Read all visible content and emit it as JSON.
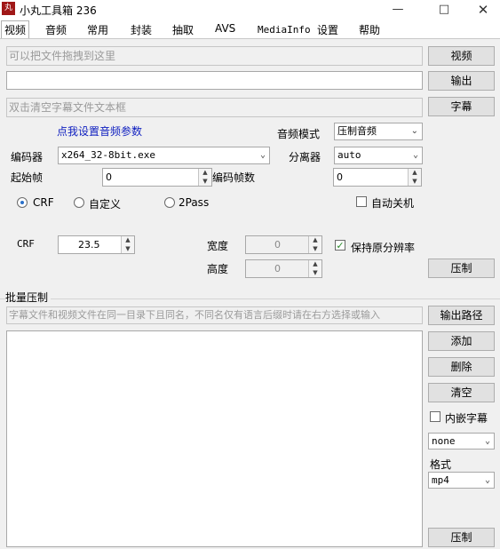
{
  "window": {
    "title": "小丸工具箱 236",
    "icon_label": "丸",
    "controls": [
      "minimize-icon",
      "maximize-icon",
      "close-icon"
    ]
  },
  "tabs": [
    "视频",
    "音频",
    "常用",
    "封装",
    "抽取",
    "AVS",
    "MediaInfo",
    "设置",
    "帮助"
  ],
  "video": {
    "drop_placeholder": "可以把文件拖拽到这里",
    "output_value": "",
    "subtitle_placeholder": "双击清空字幕文件文本框",
    "btn_video": "视频",
    "btn_output": "输出",
    "btn_subtitle": "字幕",
    "audio_link": "点我设置音频参数",
    "audio_mode_label": "音频模式",
    "audio_mode_value": "压制音频",
    "encoder_label": "编码器",
    "encoder_value": "x264_32-8bit.exe",
    "splitter_label": "分离器",
    "splitter_value": "auto",
    "start_frame_label": "起始帧",
    "start_frame_value": "0",
    "encode_frames_label": "编码帧数",
    "encode_frames_value": "0",
    "mode_crf": "CRF",
    "mode_custom": "自定义",
    "mode_2pass": "2Pass",
    "selected_mode": "CRF",
    "auto_shutdown_label": "自动关机",
    "auto_shutdown_checked": false,
    "crf_label": "CRF",
    "crf_value": "23.5",
    "width_label": "宽度",
    "width_value": "0",
    "height_label": "高度",
    "height_value": "0",
    "keep_res_label": "保持原分辨率",
    "keep_res_checked": true,
    "btn_encode": "压制"
  },
  "batch": {
    "section_label": "批量压制",
    "hint_placeholder": "字幕文件和视频文件在同一目录下且同名，不同名仅有语言后缀时请在右方选择或输入",
    "btn_output_path": "输出路径",
    "btn_add": "添加",
    "btn_delete": "删除",
    "btn_clear": "清空",
    "embed_sub_label": "内嵌字幕",
    "embed_sub_checked": false,
    "sub_lang_value": "none",
    "format_label": "格式",
    "format_value": "mp4",
    "btn_encode": "压制"
  },
  "colors": {
    "app_icon": "#a01818",
    "link": "#1020c0",
    "check": "#2a8a2a",
    "radio_dot": "#2a70c9"
  }
}
